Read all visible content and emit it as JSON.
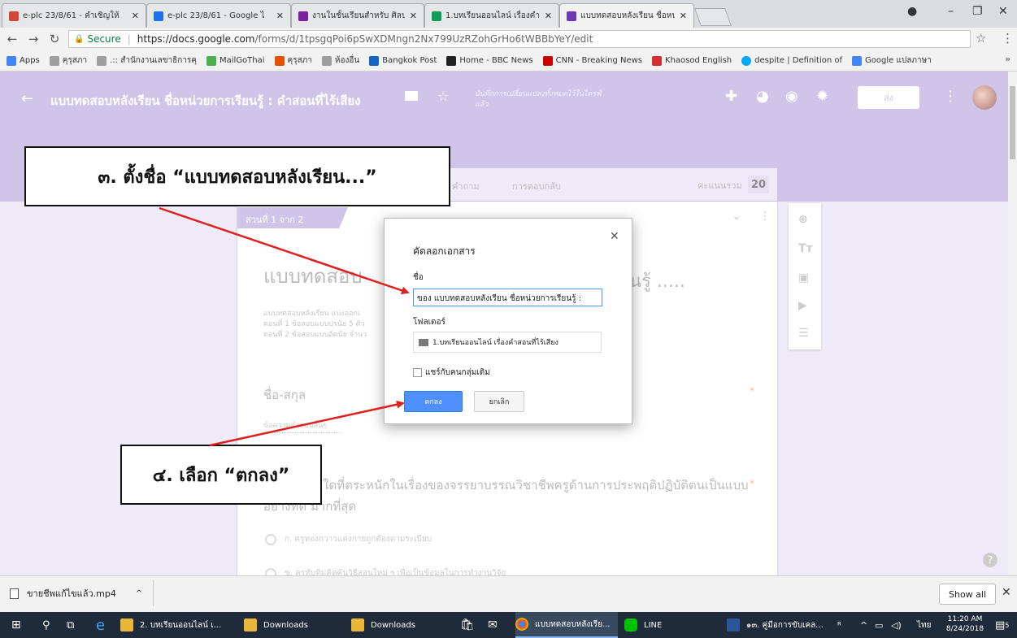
{
  "tabs": [
    {
      "label": "e-plc 23/8/61 - คำเชิญให้",
      "color": "#d44638"
    },
    {
      "label": "e-plc 23/8/61 - Google ไ",
      "color": "#1a73e8"
    },
    {
      "label": "งานในชั้นเรียนสำหรับ ศิลปะไ",
      "color": "#7b1fa2"
    },
    {
      "label": "1.บทเรียนออนไลน์ เรื่องคำสอ",
      "color": "#0f9d58"
    },
    {
      "label": "แบบทดสอบหลังเรียน ชื่อหน่ว",
      "color": "#673ab7"
    }
  ],
  "address": {
    "secure": "Secure",
    "host": "https://docs.google.com",
    "path": "/forms/d/1tpsgqPoi6pSwXDMngn2Nx799UzRZohGrHo6tWBBbYeY/edit"
  },
  "bookmarks": [
    {
      "label": "Apps",
      "color": "#4285f4"
    },
    {
      "label": "คุรุสภา",
      "color": "#9e9e9e"
    },
    {
      "label": ".:: สำนักงานเลขาธิการคุ",
      "color": "#9e9e9e"
    },
    {
      "label": "MailGoThai",
      "color": "#4caf50"
    },
    {
      "label": "คุรุสภา",
      "color": "#e65100"
    },
    {
      "label": "ห้องอื่น",
      "color": "#9e9e9e"
    },
    {
      "label": "Bangkok Post",
      "color": "#1565c0"
    },
    {
      "label": "Home - BBC News",
      "color": "#222222"
    },
    {
      "label": "CNN - Breaking News",
      "color": "#cc0000"
    },
    {
      "label": "Khaosod English",
      "color": "#d32f2f"
    },
    {
      "label": "despite | Definition of",
      "color": "#03a9f4"
    },
    {
      "label": "Google แปลภาษา",
      "color": "#4285f4"
    }
  ],
  "form": {
    "title": "แบบทดสอบหลังเรียน ชื่อหน่วยการเรียนรู้ : คำสอนที่ไร้เสียง",
    "saved_note": "บันทึกการเปลี่ยนแปลงทั้งหมดไว้ในไดรฟ์แล้ว",
    "send": "ส่ง",
    "tab_questions": "คำถาม",
    "tab_responses": "การตอบกลับ",
    "total_score_label": "คะแนนรวม",
    "total_score": "20",
    "section": "ส่วนที่ 1 จาก 2",
    "form_title": "แบบทดสอบ",
    "form_title_tail": "นรู้ .....",
    "description": [
      "แบบทดสอบหลังเรียน แบ่งออกเ",
      "ตอนที่ 1 ข้อสอบแบบปรนัย 5 ตัว",
      "ตอนที่ 2 ข้อสอบแบบอัตนัย จำนว"
    ],
    "q_name": "ชื่อ-สกุล",
    "q_name_hint": "ข้อความคำตอบสั้นๆ",
    "q2": "ข้อใดในข้อใดที่ตระหนักในเรื่องของจรรยาบรรณวิชาชีพครูด้านการประพฤติปฏิบัติตนเป็นแบบอย่างที่ดี มากที่สุด",
    "opt1": "ก. ครูทองกวาวแต่งกายถูกต้องตามระเบียบ",
    "opt2": "ข. ครูทับทิมคิดค้นวิธีสอนใหม่ ๆ เพื่อเป็นข้อมูลในการทำงานวิจัย"
  },
  "dialog": {
    "title": "คัดลอกเอกสาร",
    "name_label": "ชื่อ",
    "name_value": "ของ แบบทดสอบหลังเรียน ชื่อหน่วยการเรียนรู้ :",
    "folder_label": "โฟลเดอร์",
    "folder_value": "1.บทเรียนออนไลน์ เรื่องคำสอนที่ไร้เสียง",
    "share_label": "แชร์กับคนกลุ่มเดิม",
    "ok": "ตกลง",
    "cancel": "ยกเลิก"
  },
  "annotations": {
    "step3": "๓. ตั้งชื่อ “แบบทดสอบหลังเรียน...”",
    "step4": "๔. เลือก “ตกลง”",
    "arrow_color": "#e02020"
  },
  "downloads": {
    "file": "ขายชีพแก้ไขแล้ว.mp4",
    "show_all": "Show all"
  },
  "taskbar": {
    "apps": [
      "2. บทเรียนออนไลน์ เ...",
      "Downloads",
      "Downloads",
      "แบบทดสอบหลังเรีย...",
      "LINE",
      "๑๓. คู่มือการขับเคล..."
    ],
    "lang": "ไทย",
    "time": "11:20 AM",
    "date": "8/24/2018",
    "notif_count": "5"
  }
}
